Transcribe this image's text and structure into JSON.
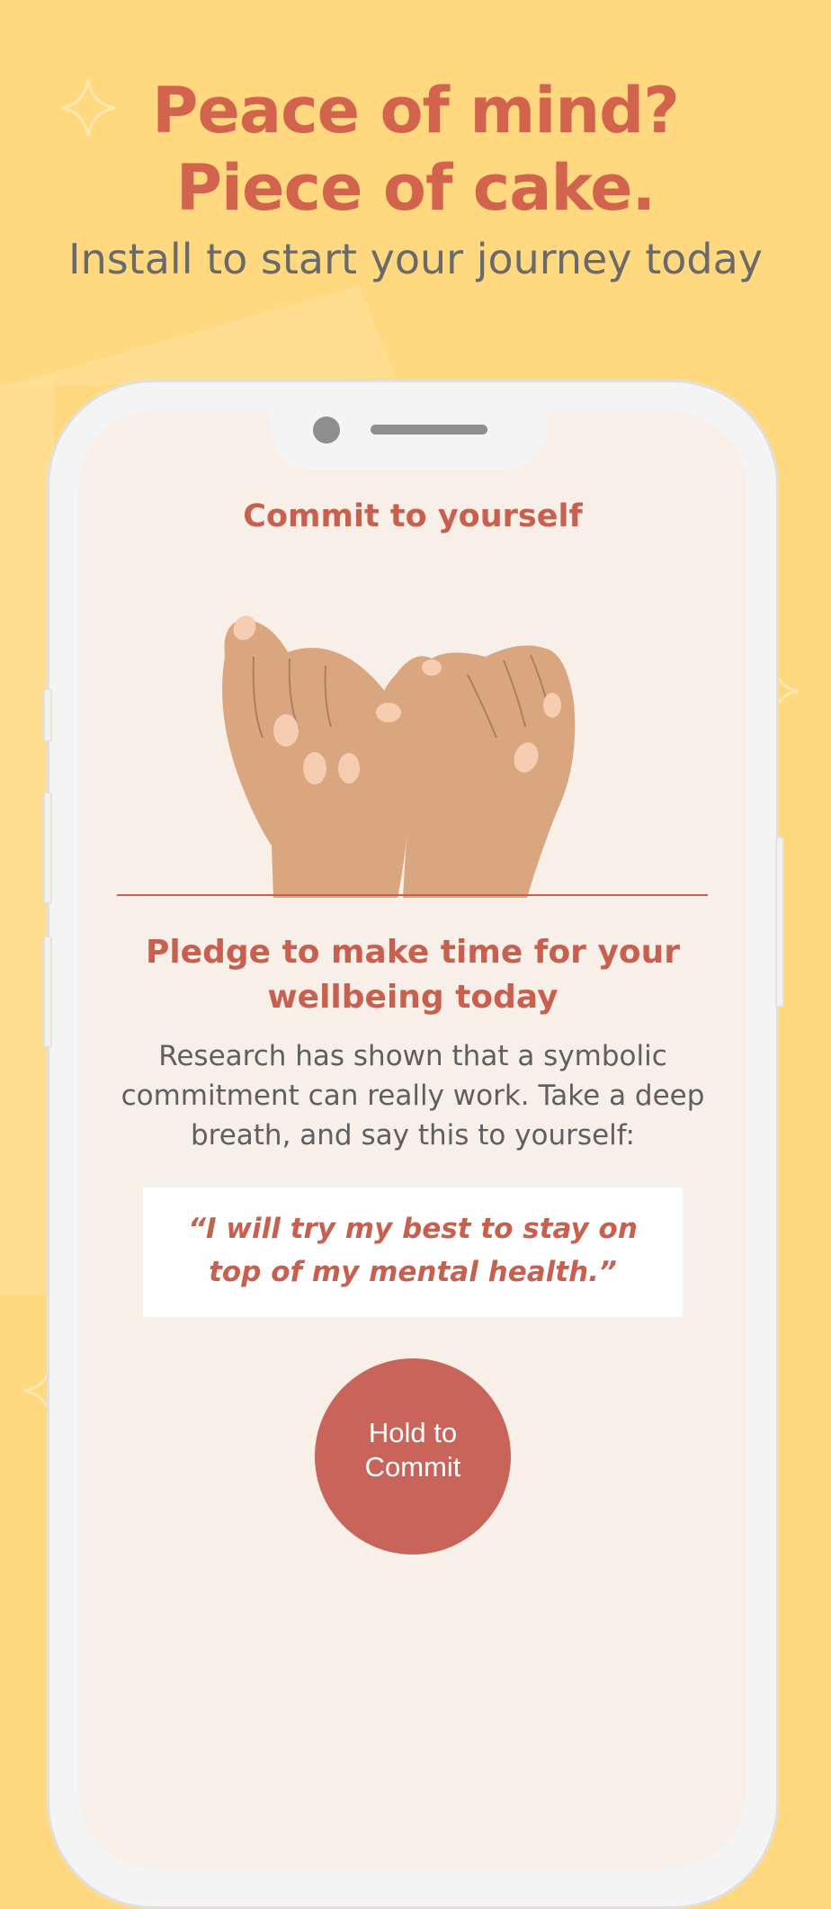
{
  "colors": {
    "background": "#FFD880",
    "accent": "#D2644E",
    "screen_background": "#F7EFE8",
    "button": "#C8645A"
  },
  "promo": {
    "headline_line1": "Peace of mind?",
    "headline_line2": "Piece of cake.",
    "subheadline": "Install to start your journey today"
  },
  "screen": {
    "title": "Commit to yourself",
    "illustration": "pinky-promise-hands-icon",
    "pledge_heading": "Pledge to make time for your wellbeing today",
    "body": "Research has shown that a symbolic commitment can really work. Take a deep breath, and say this to yourself:",
    "quote": "“I will try my best to stay on top of my mental health.”",
    "commit_button_label": "Hold to Commit"
  }
}
